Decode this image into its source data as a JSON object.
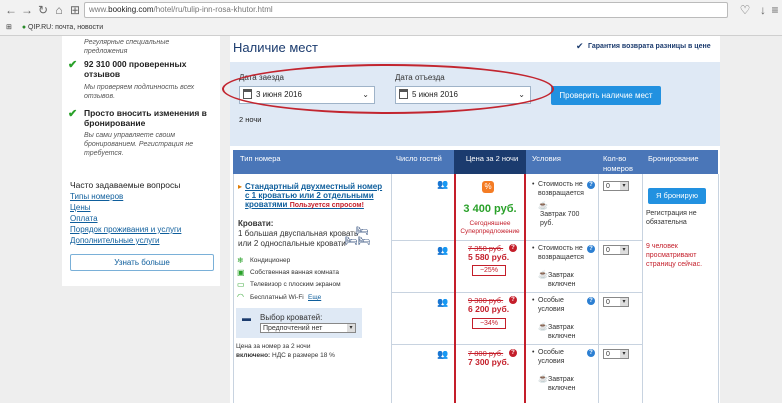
{
  "browser": {
    "url_prefix": "www.",
    "url_domain": "booking.com",
    "url_path": "/hotel/ru/tulip-inn-rosa-khutor.html",
    "bookmark": "QIP.RU: почта, новости"
  },
  "sidebar": {
    "top_cut": "Регулярные специальные предложения",
    "features": [
      {
        "title": "92 310 000 проверенных отзывов",
        "sub": "Мы проверяем подлинность всех отзывов."
      },
      {
        "title": "Просто вносить изменения в бронирование",
        "sub": "Вы сами управляете своим бронированием. Регистрация не требуется."
      }
    ]
  },
  "faq": {
    "title": "Часто задаваемые вопросы",
    "links": [
      "Типы номеров",
      "Цены",
      "Оплата",
      "Порядок проживания и услуги",
      "Дополнительные услуги"
    ],
    "learn_more": "Узнать больше"
  },
  "availability": {
    "title": "Наличие мест",
    "guarantee": "Гарантия возврата разницы в цене",
    "checkin_label": "Дата заезда",
    "checkin_value": "3 июня 2016",
    "checkout_label": "Дата отъезда",
    "checkout_value": "5 июня 2016",
    "check_button": "Проверить наличие мест",
    "nights": "2 ночи"
  },
  "table": {
    "headers": {
      "room_type": "Тип номера",
      "guests": "Число гостей",
      "price": "Цена за 2 ночи",
      "conditions": "Условия",
      "count": "Кол-во номеров",
      "booking": "Бронирование"
    },
    "room": {
      "name": "Стандартный двухместный номер с 1 кроватью или 2 отдельными кроватями",
      "demand": "Пользуется спросом!",
      "beds_label": "Кровати:",
      "bed1": "1 большая двуспальная кровать",
      "bed2": "или 2 односпальные кровати",
      "amenities": [
        "Кондиционер",
        "Собственная ванная комната",
        "Телевизор с плоским экраном"
      ],
      "wifi": "Бесплатный Wi-Fi",
      "wifi_more": "Еще",
      "bed_choice_label": "Выбор кроватей:",
      "bed_choice_value": "Предпочтений нет",
      "price_note": "Цена за номер за 2 ночи",
      "vat_bold": "включено:",
      "vat_rest": "НДС в размере 18 %"
    },
    "rows": [
      {
        "price": "3 400 руб.",
        "deal": "Сегодняшнее Суперпредложение",
        "cond1": "Стоимость не возвращается",
        "cond2": "Завтрак 700 руб.",
        "select": "0"
      },
      {
        "old": "7 350 руб.",
        "price": "5 580 руб.",
        "discount": "−25%",
        "cond1": "Стоимость не возвращается",
        "cond2": "Завтрак включен",
        "select": "0"
      },
      {
        "old": "9 300 руб.",
        "price": "6 200 руб.",
        "discount": "−34%",
        "cond1": "Особые условия",
        "cond2": "Завтрак включен",
        "select": "0"
      },
      {
        "old": "7 800 руб.",
        "price": "7 300 руб.",
        "cond1": "Особые условия",
        "cond2": "Завтрак включен",
        "select": "0"
      }
    ],
    "book_button": "Я бронирую",
    "reg_note": "Регистрация не обязательна",
    "viewers": "9 человек просматривают страницу сейчас."
  }
}
